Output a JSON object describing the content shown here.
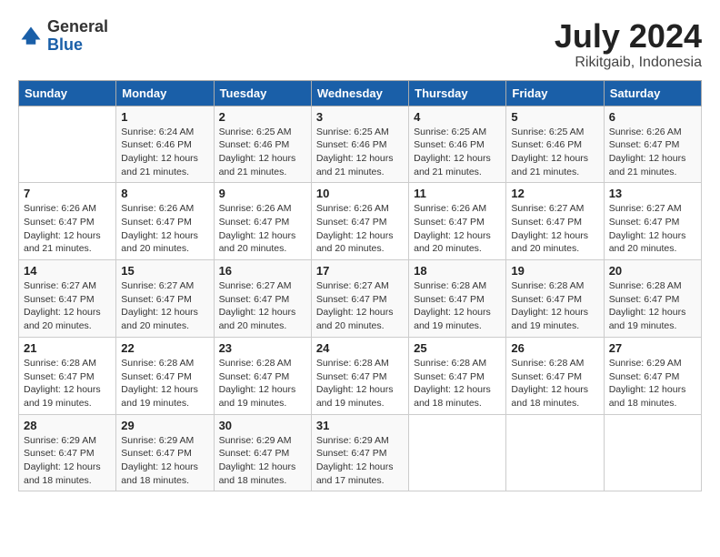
{
  "header": {
    "logo_general": "General",
    "logo_blue": "Blue",
    "month": "July 2024",
    "location": "Rikitgaib, Indonesia"
  },
  "days_of_week": [
    "Sunday",
    "Monday",
    "Tuesday",
    "Wednesday",
    "Thursday",
    "Friday",
    "Saturday"
  ],
  "weeks": [
    [
      {
        "day": "",
        "detail": ""
      },
      {
        "day": "1",
        "detail": "Sunrise: 6:24 AM\nSunset: 6:46 PM\nDaylight: 12 hours\nand 21 minutes."
      },
      {
        "day": "2",
        "detail": "Sunrise: 6:25 AM\nSunset: 6:46 PM\nDaylight: 12 hours\nand 21 minutes."
      },
      {
        "day": "3",
        "detail": "Sunrise: 6:25 AM\nSunset: 6:46 PM\nDaylight: 12 hours\nand 21 minutes."
      },
      {
        "day": "4",
        "detail": "Sunrise: 6:25 AM\nSunset: 6:46 PM\nDaylight: 12 hours\nand 21 minutes."
      },
      {
        "day": "5",
        "detail": "Sunrise: 6:25 AM\nSunset: 6:46 PM\nDaylight: 12 hours\nand 21 minutes."
      },
      {
        "day": "6",
        "detail": "Sunrise: 6:26 AM\nSunset: 6:47 PM\nDaylight: 12 hours\nand 21 minutes."
      }
    ],
    [
      {
        "day": "7",
        "detail": "Sunrise: 6:26 AM\nSunset: 6:47 PM\nDaylight: 12 hours\nand 21 minutes."
      },
      {
        "day": "8",
        "detail": "Sunrise: 6:26 AM\nSunset: 6:47 PM\nDaylight: 12 hours\nand 20 minutes."
      },
      {
        "day": "9",
        "detail": "Sunrise: 6:26 AM\nSunset: 6:47 PM\nDaylight: 12 hours\nand 20 minutes."
      },
      {
        "day": "10",
        "detail": "Sunrise: 6:26 AM\nSunset: 6:47 PM\nDaylight: 12 hours\nand 20 minutes."
      },
      {
        "day": "11",
        "detail": "Sunrise: 6:26 AM\nSunset: 6:47 PM\nDaylight: 12 hours\nand 20 minutes."
      },
      {
        "day": "12",
        "detail": "Sunrise: 6:27 AM\nSunset: 6:47 PM\nDaylight: 12 hours\nand 20 minutes."
      },
      {
        "day": "13",
        "detail": "Sunrise: 6:27 AM\nSunset: 6:47 PM\nDaylight: 12 hours\nand 20 minutes."
      }
    ],
    [
      {
        "day": "14",
        "detail": "Sunrise: 6:27 AM\nSunset: 6:47 PM\nDaylight: 12 hours\nand 20 minutes."
      },
      {
        "day": "15",
        "detail": "Sunrise: 6:27 AM\nSunset: 6:47 PM\nDaylight: 12 hours\nand 20 minutes."
      },
      {
        "day": "16",
        "detail": "Sunrise: 6:27 AM\nSunset: 6:47 PM\nDaylight: 12 hours\nand 20 minutes."
      },
      {
        "day": "17",
        "detail": "Sunrise: 6:27 AM\nSunset: 6:47 PM\nDaylight: 12 hours\nand 20 minutes."
      },
      {
        "day": "18",
        "detail": "Sunrise: 6:28 AM\nSunset: 6:47 PM\nDaylight: 12 hours\nand 19 minutes."
      },
      {
        "day": "19",
        "detail": "Sunrise: 6:28 AM\nSunset: 6:47 PM\nDaylight: 12 hours\nand 19 minutes."
      },
      {
        "day": "20",
        "detail": "Sunrise: 6:28 AM\nSunset: 6:47 PM\nDaylight: 12 hours\nand 19 minutes."
      }
    ],
    [
      {
        "day": "21",
        "detail": "Sunrise: 6:28 AM\nSunset: 6:47 PM\nDaylight: 12 hours\nand 19 minutes."
      },
      {
        "day": "22",
        "detail": "Sunrise: 6:28 AM\nSunset: 6:47 PM\nDaylight: 12 hours\nand 19 minutes."
      },
      {
        "day": "23",
        "detail": "Sunrise: 6:28 AM\nSunset: 6:47 PM\nDaylight: 12 hours\nand 19 minutes."
      },
      {
        "day": "24",
        "detail": "Sunrise: 6:28 AM\nSunset: 6:47 PM\nDaylight: 12 hours\nand 19 minutes."
      },
      {
        "day": "25",
        "detail": "Sunrise: 6:28 AM\nSunset: 6:47 PM\nDaylight: 12 hours\nand 18 minutes."
      },
      {
        "day": "26",
        "detail": "Sunrise: 6:28 AM\nSunset: 6:47 PM\nDaylight: 12 hours\nand 18 minutes."
      },
      {
        "day": "27",
        "detail": "Sunrise: 6:29 AM\nSunset: 6:47 PM\nDaylight: 12 hours\nand 18 minutes."
      }
    ],
    [
      {
        "day": "28",
        "detail": "Sunrise: 6:29 AM\nSunset: 6:47 PM\nDaylight: 12 hours\nand 18 minutes."
      },
      {
        "day": "29",
        "detail": "Sunrise: 6:29 AM\nSunset: 6:47 PM\nDaylight: 12 hours\nand 18 minutes."
      },
      {
        "day": "30",
        "detail": "Sunrise: 6:29 AM\nSunset: 6:47 PM\nDaylight: 12 hours\nand 18 minutes."
      },
      {
        "day": "31",
        "detail": "Sunrise: 6:29 AM\nSunset: 6:47 PM\nDaylight: 12 hours\nand 17 minutes."
      },
      {
        "day": "",
        "detail": ""
      },
      {
        "day": "",
        "detail": ""
      },
      {
        "day": "",
        "detail": ""
      }
    ]
  ]
}
